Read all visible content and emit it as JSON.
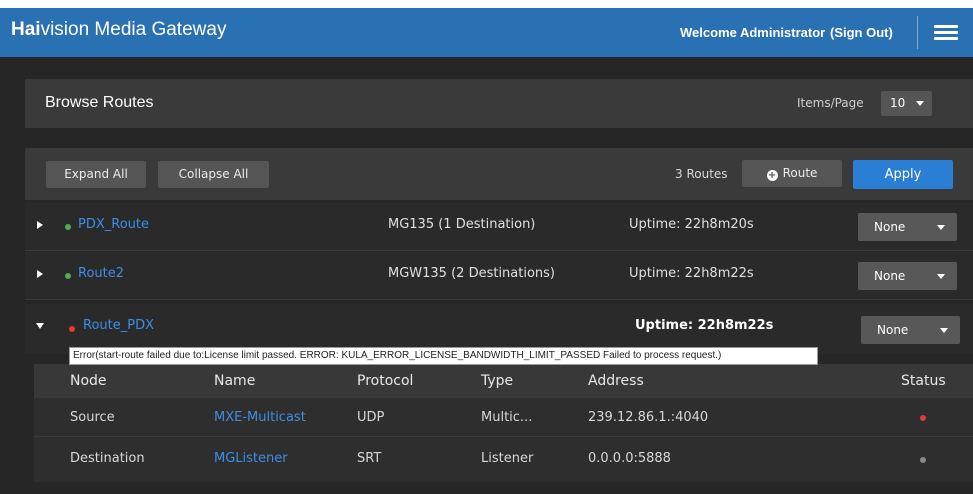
{
  "header": {
    "brand_bold": "Hai",
    "brand_rest": "vision Media Gateway",
    "welcome": "Welcome Administrator",
    "sign_out": "(Sign Out)",
    "menu_icon": "hamburger-icon",
    "color": "#2a71b4"
  },
  "browse": {
    "title": "Browse Routes",
    "items_per_page_label": "Items/Page",
    "items_per_page_value": "10"
  },
  "toolbar": {
    "expand_all": "Expand All",
    "collapse_all": "Collapse All",
    "routes_count": "3 Routes",
    "add_route": "Route",
    "apply": "Apply"
  },
  "routes": [
    {
      "name": "PDX_Route",
      "destinations": "MG135 (1 Destination)",
      "uptime": "Uptime: 22h8m20s",
      "status_color": "#4caf50",
      "action": "None",
      "expanded": false
    },
    {
      "name": "Route2",
      "destinations": "MGW135 (2 Destinations)",
      "uptime": "Uptime: 22h8m22s",
      "status_color": "#4caf50",
      "action": "None",
      "expanded": false
    },
    {
      "name": "Route_PDX",
      "destinations": "",
      "uptime": "Uptime: 22h8m22s",
      "status_color": "#e53935",
      "action": "None",
      "expanded": true
    }
  ],
  "tooltip": "Error(start-route failed due to:License limit passed. ERROR: KULA_ERROR_LICENSE_BANDWIDTH_LIMIT_PASSED Failed to process request.)",
  "detail_table": {
    "headers": [
      "Node",
      "Name",
      "Protocol",
      "Type",
      "Address",
      "Status"
    ],
    "rows": [
      {
        "node": "Source",
        "name": "MXE-Multicast",
        "protocol": "UDP",
        "type": "Multic...",
        "address": "239.12.86.1.:4040",
        "status_color": "#e53935"
      },
      {
        "node": "Destination",
        "name": "MGListener",
        "protocol": "SRT",
        "type": "Listener",
        "address": "0.0.0.0:5888",
        "status_color": "#8a8a8a"
      }
    ]
  }
}
